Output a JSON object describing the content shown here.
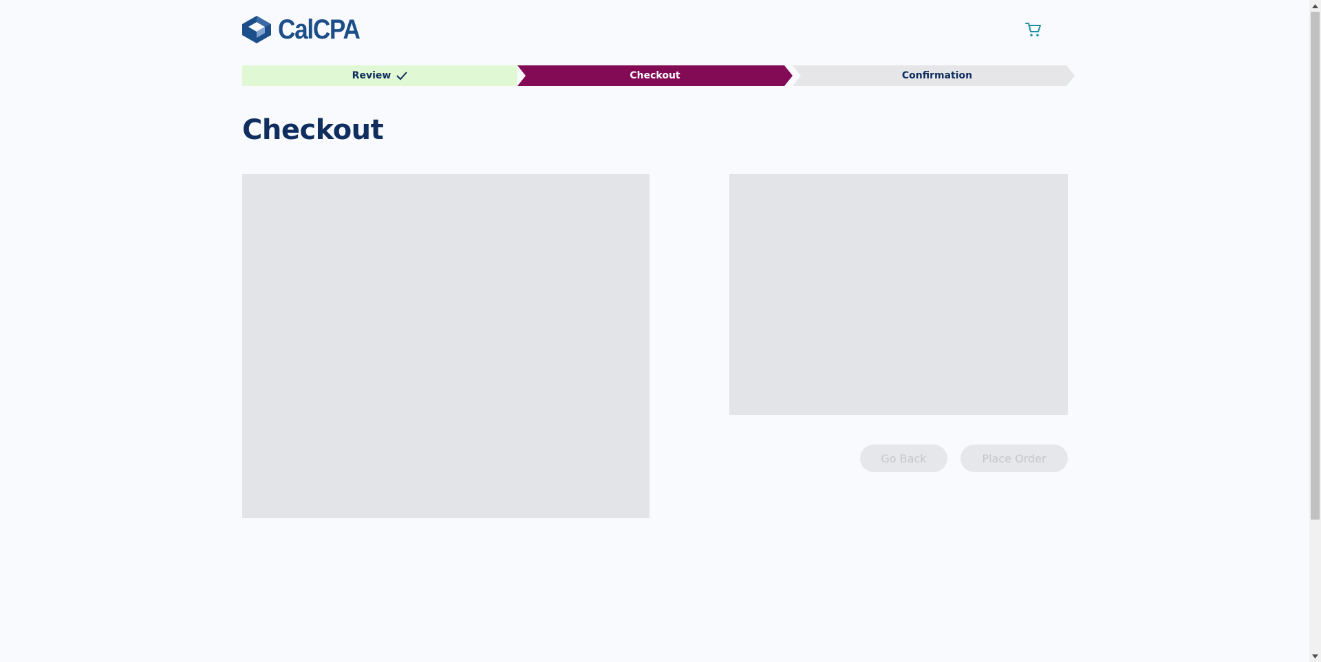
{
  "header": {
    "logo_text": "CalCPA",
    "logo_icon": "calcpa-logo-mark",
    "cart_icon": "cart-icon"
  },
  "steps": [
    {
      "label": "Review",
      "state": "complete"
    },
    {
      "label": "Checkout",
      "state": "active"
    },
    {
      "label": "Confirmation",
      "state": "upcoming"
    }
  ],
  "page": {
    "title": "Checkout"
  },
  "actions": {
    "go_back_label": "Go Back",
    "place_order_label": "Place Order"
  },
  "colors": {
    "brand_blue": "#1c4e8a",
    "active_step": "#830b55",
    "complete_step": "#e0f8d4",
    "upcoming_step": "#e6e6e8",
    "cart_accent": "#1a8fa0"
  }
}
